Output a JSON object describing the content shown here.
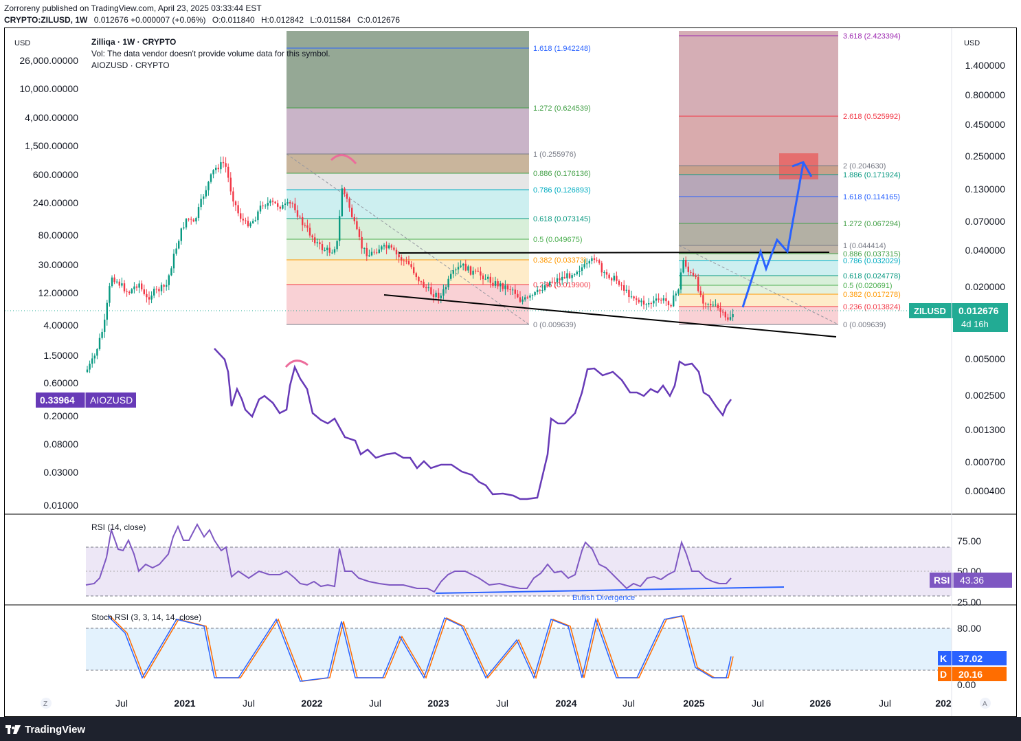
{
  "header": {
    "published": "Zorroreny published on TradingView.com, April 23, 2025 03:33:44 EST",
    "symbol": "CRYPTO:ZILUSD, 1W",
    "close_change": "0.012676 +0.000007 (+0.06%)",
    "open": "O:0.011840",
    "high": "H:0.012842",
    "low": "L:0.011584",
    "close": "C:0.012676"
  },
  "legend": {
    "title": "Zilliqa · 1W · CRYPTO",
    "vol_note": "Vol: The data vendor doesn't provide volume data for this symbol.",
    "compare": "AIOZUSD · CRYPTO"
  },
  "left_axis": {
    "currency": "USD",
    "ticks": [
      "26,000.00000",
      "10,000.00000",
      "4,000.00000",
      "1,500.00000",
      "600.00000",
      "240.00000",
      "80.00000",
      "30.00000",
      "12.00000",
      "4.00000",
      "1.50000",
      "0.60000",
      "0.20000",
      "0.08000",
      "0.03000",
      "0.01000"
    ],
    "compare_badge_value": "0.33964",
    "compare_badge_label": "AIOZUSD"
  },
  "right_axis": {
    "currency": "USD",
    "ticks": [
      "1.400000",
      "0.800000",
      "0.450000",
      "0.250000",
      "0.130000",
      "0.070000",
      "0.040000",
      "0.020000",
      "0.005000",
      "0.002500",
      "0.001300",
      "0.000700",
      "0.000400"
    ],
    "price_label": "ZILUSD",
    "price_value": "0.012676",
    "countdown": "4d 16h"
  },
  "time_axis": {
    "labels": [
      "Jul",
      "2021",
      "Jul",
      "2022",
      "Jul",
      "2023",
      "Jul",
      "2024",
      "Jul",
      "2025",
      "Jul",
      "2026",
      "Jul",
      "202"
    ],
    "left_icon": "Z",
    "right_icon": "A"
  },
  "fib_left": {
    "levels": [
      {
        "ratio": "1.618",
        "text": "1.618 (1.942248)",
        "color": "#2962ff"
      },
      {
        "ratio": "1.272",
        "text": "1.272 (0.624539)",
        "color": "#43a047"
      },
      {
        "ratio": "1",
        "text": "1 (0.255976)",
        "color": "#787b86"
      },
      {
        "ratio": "0.886",
        "text": "0.886 (0.176136)",
        "color": "#43a047"
      },
      {
        "ratio": "0.786",
        "text": "0.786 (0.126893)",
        "color": "#00acc1"
      },
      {
        "ratio": "0.618",
        "text": "0.618 (0.073145)",
        "color": "#089981"
      },
      {
        "ratio": "0.5",
        "text": "0.5 (0.049675)",
        "color": "#4caf50"
      },
      {
        "ratio": "0.382",
        "text": "0.382 (0.03373)",
        "color": "#ff9800"
      },
      {
        "ratio": "0.236",
        "text": "0.236 (0.019900)",
        "color": "#f23645"
      },
      {
        "ratio": "0",
        "text": "0 (0.009639)",
        "color": "#787b86"
      }
    ]
  },
  "fib_right": {
    "levels": [
      {
        "ratio": "3.618",
        "text": "3.618 (2.423394)",
        "color": "#9c27b0"
      },
      {
        "ratio": "2.618",
        "text": "2.618 (0.525992)",
        "color": "#f23645"
      },
      {
        "ratio": "2",
        "text": "2 (0.204630)",
        "color": "#787b86"
      },
      {
        "ratio": "1.886",
        "text": "1.886 (0.171924)",
        "color": "#089981"
      },
      {
        "ratio": "1.618",
        "text": "1.618 (0.114165)",
        "color": "#2962ff"
      },
      {
        "ratio": "1.272",
        "text": "1.272 (0.067294)",
        "color": "#43a047"
      },
      {
        "ratio": "1",
        "text": "1 (0.044414)",
        "color": "#787b86"
      },
      {
        "ratio": "0.886",
        "text": "0.886 (0.037315)",
        "color": "#43a047"
      },
      {
        "ratio": "0.786",
        "text": "0.786 (0.032029)",
        "color": "#00acc1"
      },
      {
        "ratio": "0.618",
        "text": "0.618 (0.024778)",
        "color": "#089981"
      },
      {
        "ratio": "0.5",
        "text": "0.5 (0.020691)",
        "color": "#4caf50"
      },
      {
        "ratio": "0.382",
        "text": "0.382 (0.017278)",
        "color": "#ff9800"
      },
      {
        "ratio": "0.236",
        "text": "0.236 (0.013824)",
        "color": "#f23645"
      },
      {
        "ratio": "0",
        "text": "0 (0.009639)",
        "color": "#787b86"
      }
    ]
  },
  "rsi": {
    "title": "RSI (14, close)",
    "ticks": [
      "75.00",
      "50.00",
      "25.00"
    ],
    "badge_label": "RSI",
    "badge_value": "43.36",
    "annotation": "Bullish Divergence"
  },
  "stoch": {
    "title": "Stoch RSI (3, 3, 14, 14, close)",
    "ticks": [
      "80.00",
      "0.00"
    ],
    "k_label": "K",
    "k_value": "37.02",
    "d_label": "D",
    "d_value": "20.16"
  },
  "colors": {
    "bull": "#089981",
    "bear": "#f23645",
    "aioz_line": "#673ab7",
    "rsi_line": "#7e57c2",
    "stoch_k": "#2962ff",
    "stoch_d": "#ff6d00",
    "projection": "#2962ff",
    "price_badge": "#22ab94"
  },
  "chart_data": {
    "type": "candlestick",
    "timeframe": "1W",
    "main_symbol": "CRYPTO:ZILUSD",
    "compare_symbol": "AIOZUSD",
    "x_range": [
      "2020-05",
      "2027-01"
    ],
    "y_scale": "log",
    "left_y_range": [
      0.01,
      26000
    ],
    "right_y_range": [
      0.0004,
      1.4
    ],
    "last_close": 0.012676,
    "zil_weekly_close_approx": [
      {
        "t": "2020-06",
        "v": 0.018
      },
      {
        "t": "2020-09",
        "v": 0.022
      },
      {
        "t": "2021-01",
        "v": 0.08
      },
      {
        "t": "2021-04",
        "v": 0.18
      },
      {
        "t": "2021-07",
        "v": 0.07
      },
      {
        "t": "2021-10",
        "v": 0.1
      },
      {
        "t": "2022-01",
        "v": 0.06
      },
      {
        "t": "2022-04",
        "v": 0.06
      },
      {
        "t": "2022-07",
        "v": 0.04
      },
      {
        "t": "2022-10",
        "v": 0.032
      },
      {
        "t": "2023-01",
        "v": 0.022
      },
      {
        "t": "2023-04",
        "v": 0.032
      },
      {
        "t": "2023-07",
        "v": 0.02
      },
      {
        "t": "2023-10",
        "v": 0.016
      },
      {
        "t": "2024-01",
        "v": 0.028
      },
      {
        "t": "2024-04",
        "v": 0.03
      },
      {
        "t": "2024-07",
        "v": 0.017
      },
      {
        "t": "2024-10",
        "v": 0.017
      },
      {
        "t": "2024-12",
        "v": 0.035
      },
      {
        "t": "2025-02",
        "v": 0.015
      },
      {
        "t": "2025-04",
        "v": 0.012676
      }
    ],
    "aioz_weekly_close_approx": [
      {
        "t": "2021-03",
        "v": 0.8
      },
      {
        "t": "2021-07",
        "v": 0.3
      },
      {
        "t": "2021-12",
        "v": 0.6
      },
      {
        "t": "2022-04",
        "v": 0.15
      },
      {
        "t": "2022-09",
        "v": 0.05
      },
      {
        "t": "2023-01",
        "v": 0.035
      },
      {
        "t": "2023-06",
        "v": 0.013
      },
      {
        "t": "2023-10",
        "v": 0.011
      },
      {
        "t": "2024-01",
        "v": 0.2
      },
      {
        "t": "2024-03",
        "v": 0.7
      },
      {
        "t": "2024-07",
        "v": 0.35
      },
      {
        "t": "2024-12",
        "v": 0.9
      },
      {
        "t": "2025-02",
        "v": 0.25
      },
      {
        "t": "2025-04",
        "v": 0.33964
      }
    ],
    "rsi_last": 43.36,
    "stoch_k_last": 37.02,
    "stoch_d_last": 20.16,
    "annotations": [
      "Bullish Divergence"
    ]
  }
}
